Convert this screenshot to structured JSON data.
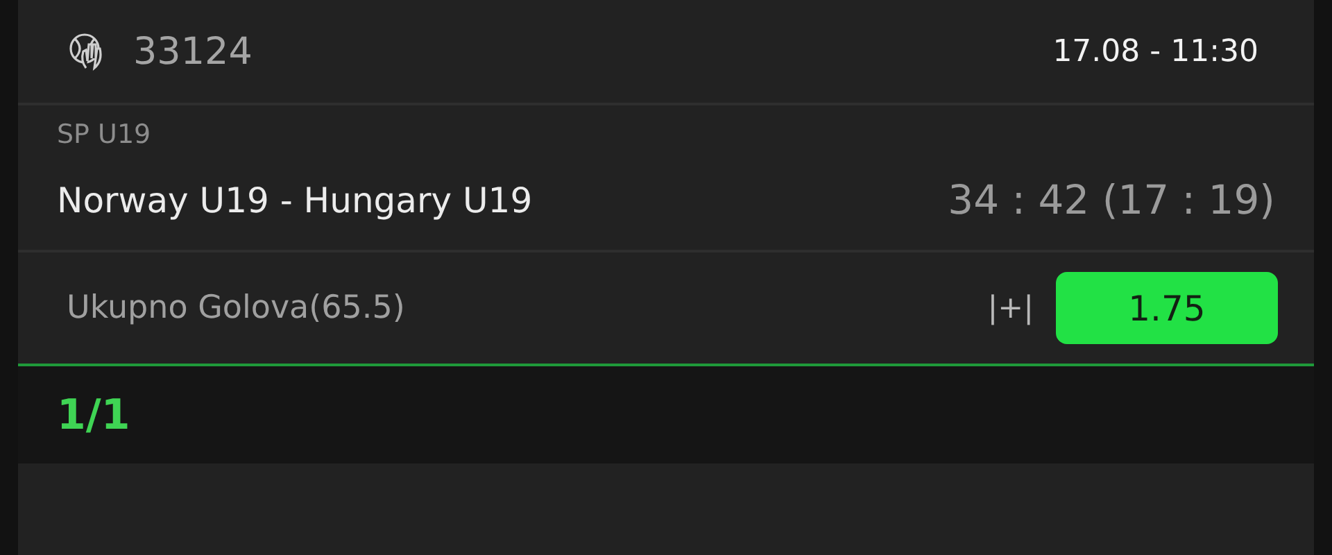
{
  "header": {
    "event_code": "33124",
    "datetime": "17.08  -  11:30"
  },
  "league": "SP U19",
  "match": {
    "teams": "Norway U19 - Hungary U19",
    "score": "34 : 42 (17 : 19)"
  },
  "bet": {
    "market": "Ukupno Golova(65.5)",
    "marker": "|+|",
    "odds": "1.75",
    "selected": true
  },
  "footer": {
    "count": "1/1"
  }
}
